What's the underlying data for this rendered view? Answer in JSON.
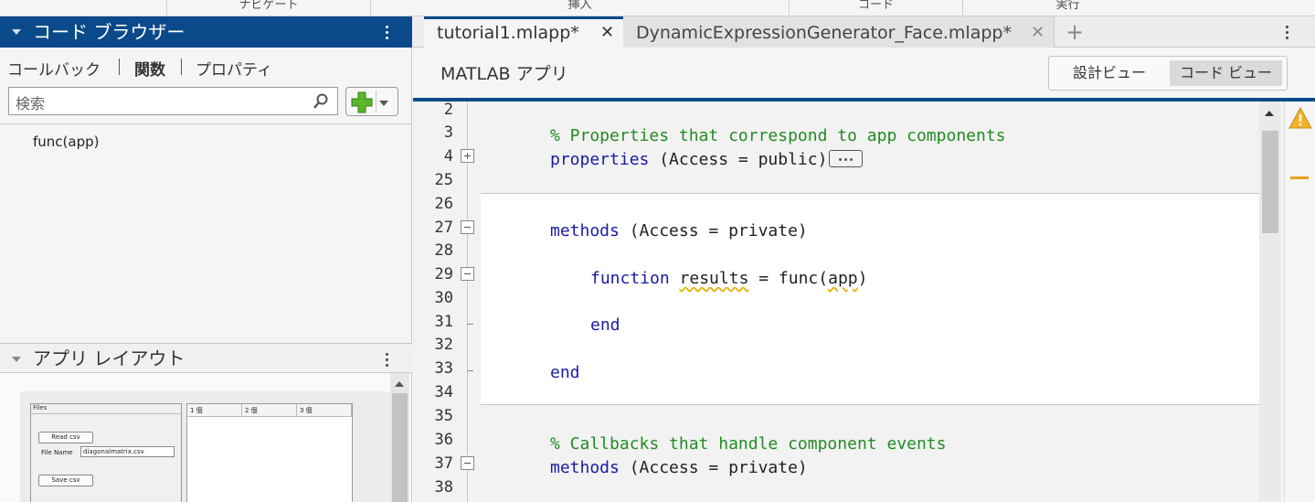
{
  "ribbon": {
    "sections": [
      "ナビゲート",
      "挿入",
      "コード",
      "実行"
    ]
  },
  "code_browser": {
    "title": "コード ブラウザー",
    "tabs": [
      "コールバック",
      "関数",
      "プロパティ"
    ],
    "active_tab": "関数",
    "search_placeholder": "検索",
    "items": [
      "func(app)"
    ]
  },
  "app_layout": {
    "title": "アプリ レイアウト",
    "preview": {
      "panel_title": "Files",
      "read_button": "Read csv",
      "file_name_label": "File Name",
      "file_name_value": "diagonalmatrix.csv",
      "save_button": "Save csv",
      "table_columns": [
        "1 個",
        "2 個",
        "3 個"
      ]
    }
  },
  "editor": {
    "tabs": [
      {
        "label": "tutorial1.mlapp*",
        "active": true
      },
      {
        "label": "DynamicExpressionGenerator_Face.mlapp*",
        "active": false
      }
    ],
    "app_title": "MATLAB アプリ",
    "view_options": [
      "設計ビュー",
      "コード ビュー"
    ],
    "selected_view": "コード ビュー",
    "line_numbers": [
      "2",
      "3",
      "4",
      "25",
      "26",
      "27",
      "28",
      "29",
      "30",
      "31",
      "32",
      "33",
      "34",
      "35",
      "36",
      "37",
      "38"
    ],
    "code": {
      "l3": "% Properties that correspond to app components",
      "l4_kw": "properties",
      "l4_rest": " (Access = public)",
      "l27_kw": "methods",
      "l27_rest": " (Access = private)",
      "l29_kw": "function",
      "l29_a": " ",
      "l29_results": "results",
      "l29_b": " = func(",
      "l29_app": "app",
      "l29_c": ")",
      "l31_kw": "end",
      "l33_kw": "end",
      "l36": "% Callbacks that handle component events",
      "l37_kw": "methods",
      "l37_rest": " (Access = private)"
    }
  },
  "colors": {
    "accent": "#0b4a8a",
    "comment": "#228b22",
    "keyword": "#1a1aa6",
    "warning": "#e8a317"
  }
}
